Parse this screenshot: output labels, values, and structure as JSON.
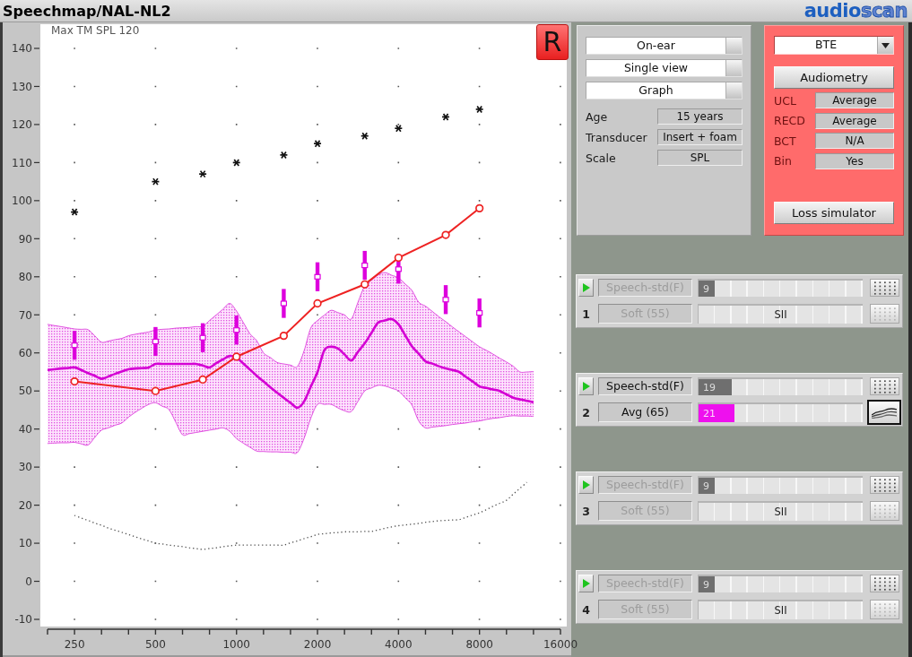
{
  "window": {
    "title": "Speechmap/NAL-NL2",
    "logo": [
      "audio",
      "scan"
    ]
  },
  "graph": {
    "ear_button": {
      "label": "R"
    },
    "chart_data": {
      "type": "line",
      "grid": true,
      "categories": [
        null,
        null,
        null,
        null,
        "250",
        null,
        null,
        null,
        null,
        null,
        null,
        null,
        null,
        null,
        null,
        null,
        "500",
        null,
        null,
        null,
        null,
        null,
        null,
        null,
        null,
        null,
        null,
        null,
        "1000",
        null,
        null,
        null,
        null,
        null,
        null,
        null,
        null,
        null,
        null,
        null,
        "2000",
        null,
        null,
        null,
        null,
        null,
        null,
        null,
        null,
        null,
        null,
        null,
        "4000",
        null,
        null,
        null,
        null,
        null,
        null,
        null,
        null,
        null,
        null,
        null,
        "8000",
        null,
        null,
        null,
        null,
        null,
        null,
        null,
        null,
        null,
        null,
        null,
        "16000"
      ],
      "ylim": [
        -12,
        146
      ],
      "yticks": [
        -10,
        0,
        10,
        20,
        30,
        40,
        50,
        60,
        70,
        80,
        90,
        100,
        110,
        120,
        130,
        140
      ],
      "annotations": [
        {
          "text": "Max TM SPL 120"
        }
      ],
      "series": [
        {
          "type": "area",
          "color": "#e050e0",
          "values": [
            67.5,
            67.2,
            66.9,
            66.6,
            66.3,
            66.2,
            66.1,
            64.5,
            62.8,
            63.1,
            63.5,
            63.8,
            64.5,
            64.9,
            65.2,
            65.5,
            66,
            66.2,
            66.3,
            66.5,
            66.6,
            66.7,
            66.9,
            67,
            68.5,
            70,
            71.5,
            73,
            71,
            68,
            65,
            63.2,
            60,
            58.8,
            57.5,
            57.1,
            56.8,
            56.4,
            60.5,
            66.5,
            68.5,
            69.9,
            71.2,
            70.6,
            70,
            68.9,
            73.3,
            77.6,
            79.1,
            80.5,
            81.1,
            80.4,
            79.7,
            78.1,
            76.4,
            73.3,
            72.3,
            70.9,
            69.5,
            68.2,
            66.8,
            65.5,
            64.2,
            62.9,
            61.6,
            60.7,
            59.7,
            58.6,
            57.6,
            56.5,
            55,
            55,
            55.1,
            null,
            null,
            null,
            null
          ]
        },
        {
          "type": "line",
          "color": "#e050e0",
          "values": [
            36.2,
            36.3,
            36.4,
            36.4,
            36.5,
            36.1,
            35.8,
            37.8,
            39.7,
            40.3,
            41,
            41.6,
            43.1,
            44.4,
            45.5,
            46.5,
            46.9,
            46,
            45.1,
            41.8,
            38.5,
            38.8,
            39.1,
            39.4,
            39.7,
            40,
            40.3,
            39.4,
            37.5,
            36.3,
            35.2,
            34.2,
            34.1,
            34,
            34,
            33.9,
            33.9,
            33.8,
            37.5,
            42.8,
            46.5,
            46.5,
            46.5,
            45.6,
            44.8,
            44.6,
            47.3,
            50,
            50.8,
            51.5,
            51.3,
            50.7,
            50,
            48.2,
            46.3,
            42.1,
            40.3,
            40.5,
            40.7,
            40.9,
            41.2,
            41.4,
            41.6,
            41.9,
            42.1,
            42.5,
            42.8,
            43,
            43.3,
            43.5,
            43.4,
            43.4,
            43.3,
            null,
            null,
            null,
            null
          ]
        },
        {
          "type": "line",
          "color": "#d400d4",
          "values": [
            55.5,
            55.7,
            55.9,
            56,
            56.2,
            55.5,
            54.7,
            54,
            53.2,
            53.8,
            54.5,
            55.1,
            55.7,
            55.9,
            56,
            56.2,
            57.1,
            57.1,
            57.1,
            57.1,
            57.1,
            57.1,
            57.1,
            56.7,
            56.2,
            57.3,
            58.3,
            59.2,
            58.8,
            57.2,
            55.6,
            54,
            52.5,
            51,
            49.6,
            48.2,
            46.9,
            45.6,
            47.2,
            51.1,
            55,
            60.7,
            61.6,
            61.2,
            59.6,
            58,
            60.3,
            62.5,
            65.3,
            68,
            68.5,
            68.9,
            67.5,
            64.6,
            61.7,
            59.8,
            57.8,
            57.2,
            56.5,
            55.9,
            55.5,
            55,
            53.7,
            52.5,
            51.2,
            50.8,
            50.4,
            50,
            49.1,
            48.2,
            47.8,
            47.4,
            47,
            null,
            null,
            null,
            null
          ]
        },
        {
          "type": "line",
          "line_style": "dotted",
          "color": "#505050",
          "values": [
            null,
            null,
            null,
            null,
            17.3,
            16.6,
            16,
            15.3,
            14.7,
            14,
            13.4,
            12.9,
            12.3,
            11.7,
            11.1,
            10.6,
            10,
            9.8,
            9.5,
            9.3,
            9.1,
            8.8,
            8.6,
            8.4,
            8.6,
            8.8,
            9.1,
            9.3,
            9.5,
            9.5,
            9.5,
            9.5,
            9.5,
            9.5,
            9.5,
            9.5,
            10.1,
            10.6,
            11.2,
            11.7,
            12.3,
            12.5,
            12.7,
            12.8,
            13,
            13,
            13,
            13.1,
            13.1,
            13.5,
            13.9,
            14.3,
            14.6,
            14.8,
            15,
            15.2,
            15.5,
            15.7,
            15.9,
            16,
            16.1,
            16.2,
            16.8,
            17.4,
            18,
            18.8,
            19.7,
            20.5,
            21.3,
            22.9,
            24.4,
            26,
            null,
            null,
            null,
            null,
            null
          ]
        },
        {
          "type": "scatter",
          "marker": "cross",
          "color": "#111111",
          "values": [
            null,
            null,
            null,
            null,
            97,
            null,
            null,
            null,
            null,
            null,
            null,
            null,
            null,
            null,
            null,
            null,
            105,
            null,
            null,
            null,
            null,
            null,
            null,
            107,
            null,
            null,
            null,
            null,
            110,
            null,
            null,
            null,
            null,
            null,
            null,
            112,
            null,
            null,
            null,
            null,
            115,
            null,
            null,
            null,
            null,
            null,
            null,
            117,
            null,
            null,
            null,
            null,
            119,
            null,
            null,
            null,
            null,
            null,
            null,
            122,
            null,
            null,
            null,
            null,
            124,
            null,
            null,
            null,
            null,
            null,
            null,
            null,
            null,
            null,
            null,
            null,
            null
          ]
        },
        {
          "type": "scatter",
          "marker": "square",
          "color": "#dd00dd",
          "values": [
            null,
            null,
            null,
            null,
            62,
            null,
            null,
            null,
            null,
            null,
            null,
            null,
            null,
            null,
            null,
            null,
            63,
            null,
            null,
            null,
            null,
            null,
            null,
            64,
            null,
            null,
            null,
            null,
            66,
            null,
            null,
            null,
            null,
            null,
            null,
            73,
            null,
            null,
            null,
            null,
            80,
            null,
            null,
            null,
            null,
            null,
            null,
            83,
            null,
            null,
            null,
            null,
            82,
            null,
            null,
            null,
            null,
            null,
            null,
            74,
            null,
            null,
            null,
            null,
            70.5,
            null,
            null,
            null,
            null,
            null,
            null,
            null,
            null,
            null,
            null,
            null,
            null
          ],
          "errors": [
            null,
            null,
            null,
            null,
            3.8,
            null,
            null,
            null,
            null,
            null,
            null,
            null,
            null,
            null,
            null,
            null,
            3.8,
            null,
            null,
            null,
            null,
            null,
            null,
            3.8,
            null,
            null,
            null,
            null,
            3.8,
            null,
            null,
            null,
            null,
            null,
            null,
            3.8,
            null,
            null,
            null,
            null,
            3.8,
            null,
            null,
            null,
            null,
            null,
            null,
            3.8,
            null,
            null,
            null,
            null,
            3.8,
            null,
            null,
            null,
            null,
            null,
            null,
            3.8,
            null,
            null,
            null,
            null,
            3.8,
            null,
            null,
            null,
            null,
            null,
            null,
            null,
            null,
            null,
            null,
            null,
            null
          ]
        },
        {
          "type": "line",
          "marker": "circle",
          "color": "#ee2222",
          "values": [
            null,
            null,
            null,
            null,
            52.5,
            null,
            null,
            null,
            null,
            null,
            null,
            null,
            null,
            null,
            null,
            null,
            50,
            null,
            null,
            null,
            null,
            null,
            null,
            53,
            null,
            null,
            null,
            null,
            59,
            null,
            null,
            null,
            null,
            null,
            null,
            64.5,
            null,
            null,
            null,
            null,
            73,
            null,
            null,
            null,
            null,
            null,
            null,
            78,
            null,
            null,
            null,
            null,
            85,
            null,
            null,
            null,
            null,
            null,
            null,
            91,
            null,
            null,
            null,
            null,
            98,
            null,
            null,
            null,
            null,
            null,
            null,
            null,
            null,
            null,
            null,
            null,
            null
          ]
        }
      ]
    }
  },
  "setup_panel": {
    "selectors": [
      "On-ear",
      "Single view",
      "Graph"
    ],
    "fields": [
      {
        "label": "Age",
        "value": "15 years"
      },
      {
        "label": "Transducer",
        "value": "Insert + foam"
      },
      {
        "label": "Scale",
        "value": "SPL"
      }
    ]
  },
  "audiometry_panel": {
    "instrument": "BTE",
    "audiometry_button": "Audiometry",
    "fields": [
      {
        "label": "UCL",
        "value": "Average"
      },
      {
        "label": "RECD",
        "value": "Average"
      },
      {
        "label": "BCT",
        "value": "N/A"
      },
      {
        "label": "Bin",
        "value": "Yes"
      }
    ],
    "loss_simulator_button": "Loss simulator"
  },
  "channels": [
    {
      "number": "1",
      "active": false,
      "stimulus": "Speech-std(F)",
      "level_name": "Soft (55)",
      "meter": {
        "reading": "9",
        "level": 0.1
      },
      "sii": {
        "text": "SII"
      }
    },
    {
      "number": "2",
      "active": true,
      "stimulus": "Speech-std(F)",
      "level_name": "Avg (65)",
      "meter": {
        "reading": "19",
        "level": 0.2
      },
      "sii": {
        "text": "21",
        "level": 0.22
      }
    },
    {
      "number": "3",
      "active": false,
      "stimulus": "Speech-std(F)",
      "level_name": "Soft (55)",
      "meter": {
        "reading": "9",
        "level": 0.1
      },
      "sii": {
        "text": "SII"
      }
    },
    {
      "number": "4",
      "active": false,
      "stimulus": "Speech-std(F)",
      "level_name": "Soft (55)",
      "meter": {
        "reading": "9",
        "level": 0.1
      },
      "sii": {
        "text": "SII"
      }
    }
  ]
}
